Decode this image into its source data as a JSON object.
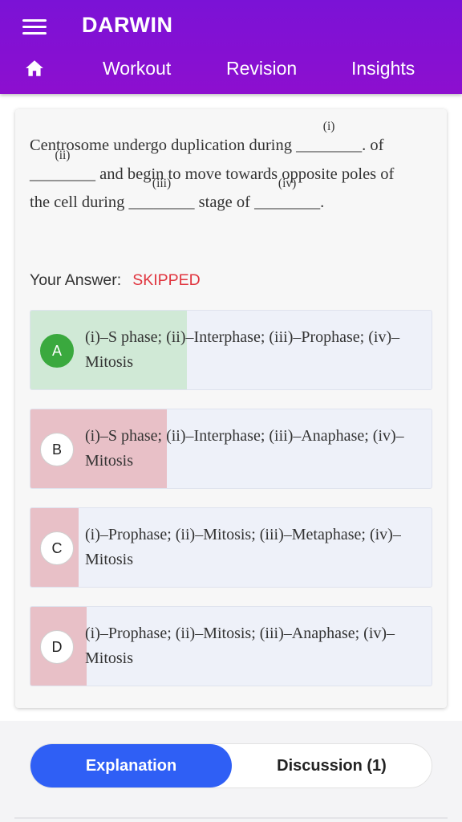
{
  "header": {
    "title": "DARWIN",
    "nav": {
      "home_icon": "home-icon",
      "tabs": [
        "Workout",
        "Revision",
        "Insights"
      ]
    },
    "color": "#7b12d6"
  },
  "question": {
    "lines": [
      {
        "pre": "Centrosome undergo duplication during ",
        "blank": "________",
        "blank_label": "(i)",
        "post": ". of"
      },
      {
        "pre": "",
        "blank": "________",
        "blank_label": "(ii)",
        "post": " and begin to move towards opposite poles of"
      },
      {
        "pre": "the cell during ",
        "blank": "________",
        "blank_label": "(iii)",
        "mid": " stage of ",
        "blank2": "________",
        "blank2_label": "(iv)",
        "post": "."
      }
    ]
  },
  "your_answer": {
    "label": "Your Answer:",
    "status": "SKIPPED",
    "status_color": "#e0353f"
  },
  "options": [
    {
      "letter": "A",
      "text": "(i)–S phase; (ii)–Interphase; (iii)–Prophase; (iv)–Mitosis",
      "state": "correct",
      "response_share": 0.39
    },
    {
      "letter": "B",
      "text": "(i)–S phase; (ii)–Interphase; (iii)–Anaphase; (iv)–Mitosis",
      "state": "wrong",
      "response_share": 0.34
    },
    {
      "letter": "C",
      "text": "(i)–Prophase; (ii)–Mitosis; (iii)–Metaphase; (iv)–Mitosis",
      "state": "wrong",
      "response_share": 0.12
    },
    {
      "letter": "D",
      "text": "(i)–Prophase; (ii)–Mitosis; (iii)–Anaphase; (iv)–Mitosis",
      "state": "wrong",
      "response_share": 0.14
    }
  ],
  "bottom_tabs": {
    "explanation": "Explanation",
    "discussion": "Discussion (1)",
    "active_color": "#2f5ff5"
  }
}
